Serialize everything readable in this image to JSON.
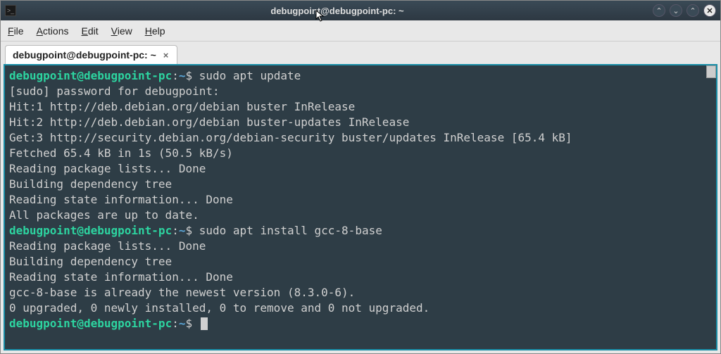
{
  "titlebar": {
    "icon_glyph": ">_",
    "title": "debugpoint@debugpoint-pc: ~",
    "btn_shade": "⌃",
    "btn_min": "⌄",
    "btn_max": "⌃",
    "btn_close": "✕"
  },
  "menubar": {
    "file": "File",
    "actions": "Actions",
    "edit": "Edit",
    "view": "View",
    "help": "Help"
  },
  "tab": {
    "label": "debugpoint@debugpoint-pc: ~",
    "close": "×"
  },
  "prompt": {
    "user": "debugpoint",
    "at": "@",
    "host": "debugpoint-pc",
    "colon": ":",
    "path": "~",
    "symbol": "$"
  },
  "lines": {
    "cmd1": " sudo apt update",
    "l1": "[sudo] password for debugpoint:",
    "l2": "Hit:1 http://deb.debian.org/debian buster InRelease",
    "l3": "Hit:2 http://deb.debian.org/debian buster-updates InRelease",
    "l4": "Get:3 http://security.debian.org/debian-security buster/updates InRelease [65.4 kB]",
    "l5": "Fetched 65.4 kB in 1s (50.5 kB/s)",
    "l6": "Reading package lists... Done",
    "l7": "Building dependency tree",
    "l8": "Reading state information... Done",
    "l9": "All packages are up to date.",
    "cmd2": " sudo apt install gcc-8-base",
    "l10": "Reading package lists... Done",
    "l11": "Building dependency tree",
    "l12": "Reading state information... Done",
    "l13": "gcc-8-base is already the newest version (8.3.0-6).",
    "l14": "0 upgraded, 0 newly installed, 0 to remove and 0 not upgraded.",
    "cmd3": " "
  }
}
